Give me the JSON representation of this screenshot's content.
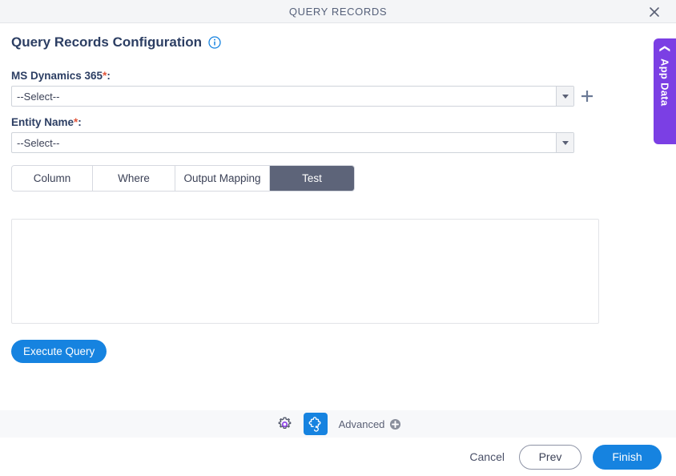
{
  "window": {
    "title": "QUERY RECORDS",
    "close_icon": "close-icon"
  },
  "heading": {
    "title": "Query Records Configuration",
    "info_icon": "info-icon"
  },
  "side_panel": {
    "label": "App Data",
    "chevron_icon": "chevron-left-icon",
    "color": "#7b3fe4"
  },
  "form": {
    "fields": [
      {
        "label": "MS Dynamics 365",
        "required_marker": "*",
        "colon": ":",
        "value": "--Select--",
        "has_add_button": true,
        "add_icon": "plus-icon"
      },
      {
        "label": "Entity Name",
        "required_marker": "*",
        "colon": ":",
        "value": "--Select--",
        "has_add_button": false,
        "add_icon": ""
      }
    ]
  },
  "tabs": [
    {
      "label": "Column",
      "active": false
    },
    {
      "label": "Where",
      "active": false
    },
    {
      "label": "Output Mapping",
      "active": false
    },
    {
      "label": "Test",
      "active": true
    }
  ],
  "test_panel": {
    "result_value": "",
    "result_placeholder": "",
    "execute_label": "Execute Query"
  },
  "toolbar": {
    "gear_icon": "gear-icon",
    "puzzle_icon": "puzzle-refresh-icon",
    "advanced_label": "Advanced",
    "advanced_add_icon": "plus-circle-icon"
  },
  "footer": {
    "cancel_label": "Cancel",
    "prev_label": "Prev",
    "finish_label": "Finish"
  },
  "colors": {
    "accent_blue": "#1683e0",
    "active_tab": "#5d6479",
    "purple": "#7b3fe4",
    "required_red": "#e0543a"
  }
}
